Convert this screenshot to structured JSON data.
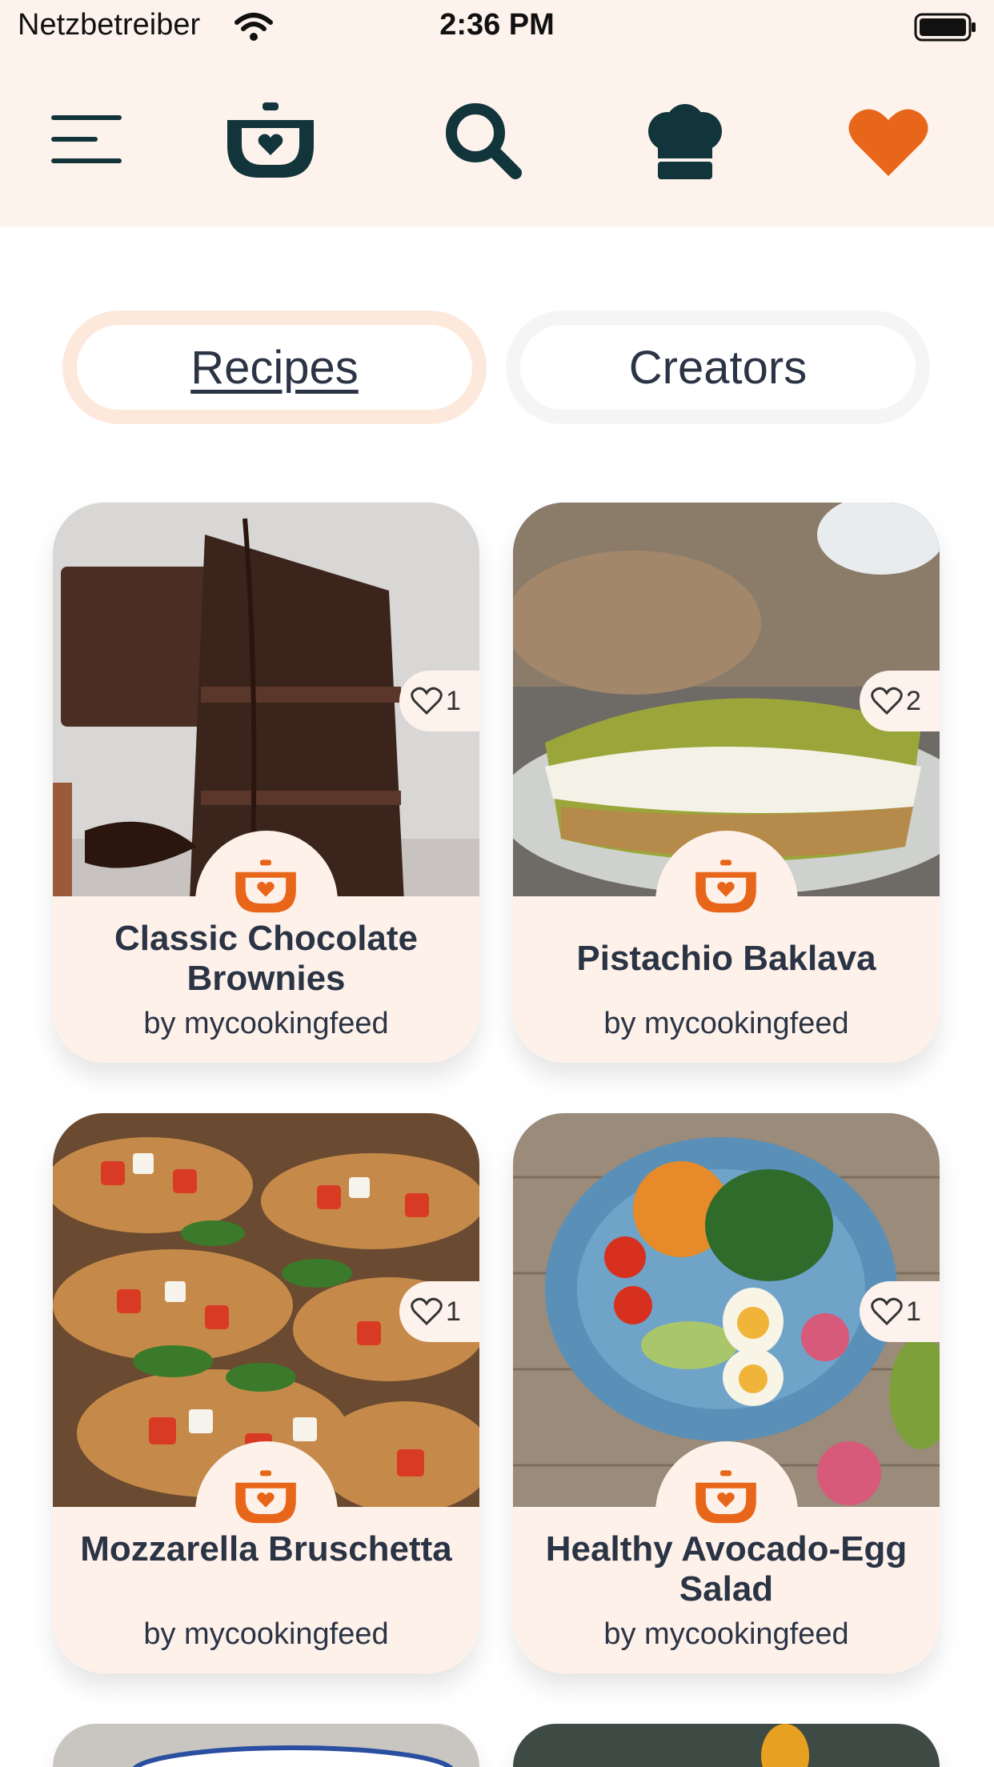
{
  "status": {
    "carrier": "Netzbetreiber",
    "time": "2:36 PM"
  },
  "nav": {
    "icons": [
      "menu-icon",
      "pot-heart-icon",
      "search-icon",
      "chef-hat-icon",
      "heart-icon"
    ],
    "accent": "#e8661a",
    "dark": "#12343b"
  },
  "tabs": {
    "recipes": "Recipes",
    "creators": "Creators"
  },
  "recipes": [
    {
      "title": "Classic Chocolate Brownies",
      "author": "by mycookingfeed",
      "likes": "1"
    },
    {
      "title": "Pistachio Baklava",
      "author": "by mycookingfeed",
      "likes": "2"
    },
    {
      "title": "Mozzarella Bruschetta",
      "author": "by mycookingfeed",
      "likes": "1"
    },
    {
      "title": "Healthy Avocado-Egg Salad",
      "author": "by mycookingfeed",
      "likes": "1"
    }
  ]
}
